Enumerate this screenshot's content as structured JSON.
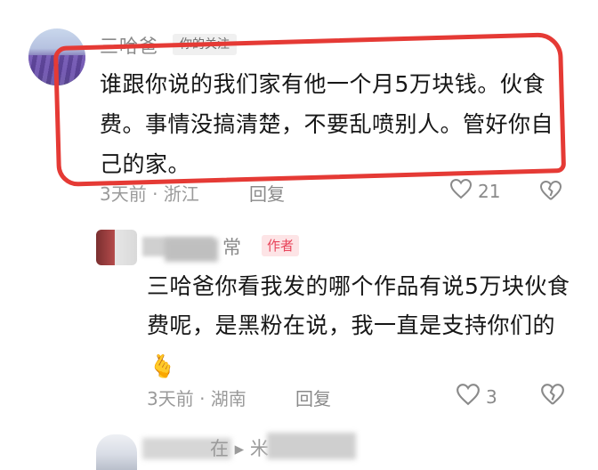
{
  "comments": [
    {
      "username": "三哈爸",
      "tag": "你的关注",
      "text": "谁跟你说的我们家有他一个月5万块钱。伙食费。事情没搞清楚，不要乱喷别人。管好你自己的家。",
      "meta": "3天前 · 浙江",
      "reply_label": "回复",
      "likes": "21"
    },
    {
      "username": "常",
      "tag": "作者",
      "text": "三哈爸你看我发的哪个作品有说5万块伙食费呢，是黑粉在说，我一直是支持你们的",
      "emoji": "🫰",
      "meta": "3天前 · 湖南",
      "reply_label": "回复",
      "likes": "3"
    },
    {
      "username": "在 ▸ 米"
    }
  ],
  "colors": {
    "highlight": "#e53a35",
    "author_tag_text": "#e8445a",
    "author_tag_bg": "#fde4e6"
  }
}
